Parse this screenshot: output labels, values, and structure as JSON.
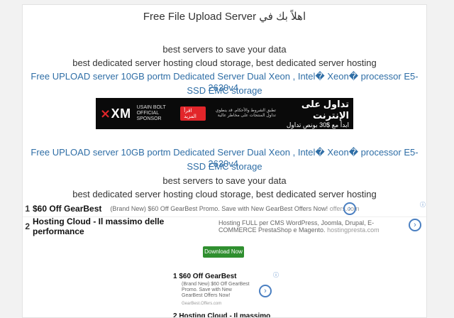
{
  "header": {
    "title": "Free File Upload Server اهلاً بك في"
  },
  "content": {
    "line1": "best servers to save your data",
    "line2": "best dedicated server hosting cloud storage, best dedicated server hosting",
    "line3": "Free UPLOAD server 10GB portm Dedicated Server Dual Xeon , Intel� Xeon� processor E5-2630v4,",
    "line4": "SSD EMC storage",
    "line5": "Free UPLOAD server 10GB portm Dedicated Server Dual Xeon , Intel� Xeon� processor E5-2630v4,",
    "line6": "SSD EMC storage",
    "line7": "best servers to save your data",
    "line8": "best dedicated server hosting cloud storage, best dedicated server hosting"
  },
  "banner": {
    "brand": "XM",
    "sponsor": "USAIN BOLT",
    "sponsor_sub": "OFFICIAL SPONSOR",
    "cta": "اقرأ المزيد",
    "small_text": "تطبق الشروط والأحكام. قد ينطوي تداول المنتجات على مخاطر عالية",
    "headline": "تداول على الإنترنت",
    "subline": "ابدأ مع $30 بونص تداول"
  },
  "ads": [
    {
      "num": "1",
      "title": "$60 Off GearBest",
      "desc": "(Brand New) $60 Off GearBest Promo. Save with New GearBest Offers Now!",
      "url": "offers.com"
    },
    {
      "num": "2",
      "title": "Hosting Cloud - Il massimo delle performance",
      "desc": "Hosting FULL per CMS WordPress, Joomla, Drupal, E-COMMERCE PrestaShop e Magento.",
      "url": "hostingpresta.com"
    }
  ],
  "download": {
    "label": "Download Now"
  },
  "ad_box": {
    "title": "1 $60 Off GearBest",
    "desc": "(Brand New) $60 Off GearBest Promo. Save with New GearBest Offers Now!",
    "url": "GearBest.Offers.com",
    "title2": "2 Hosting Cloud - Il massimo"
  },
  "colors": {
    "link_blue": "#2f6ea6",
    "download_green": "#2f8f2f",
    "banner_red": "#e2252a"
  },
  "icons": [
    "chevron-right-icon",
    "adchoices-icon"
  ]
}
